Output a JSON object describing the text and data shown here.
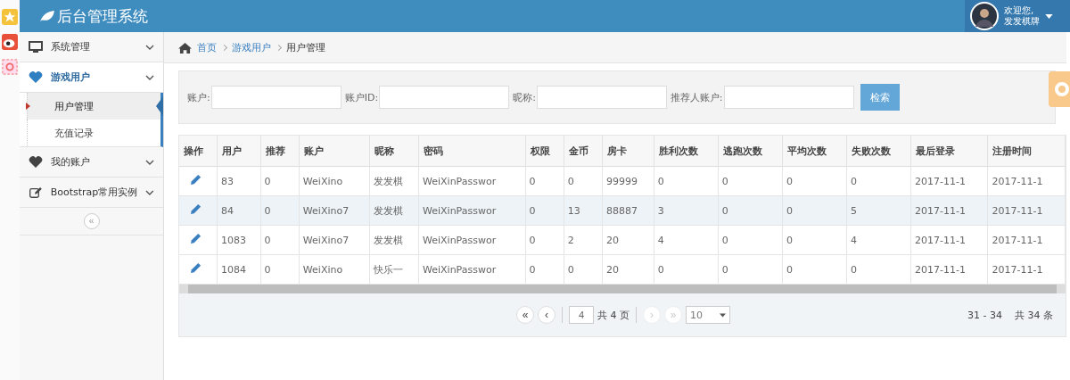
{
  "header": {
    "title": "后台管理系统",
    "user": {
      "greeting": "欢迎您,",
      "name": "发发棋牌"
    }
  },
  "sidebar": {
    "items": [
      {
        "label": "系统管理",
        "selected": false
      },
      {
        "label": "游戏用户",
        "selected": true,
        "children": [
          {
            "label": "用户管理",
            "selected": true
          },
          {
            "label": "充值记录",
            "selected": false
          }
        ]
      },
      {
        "label": "我的账户",
        "selected": false
      },
      {
        "label": "Bootstrap常用实例",
        "selected": false
      }
    ],
    "collapse": "«"
  },
  "breadcrumb": [
    "首页",
    "游戏用户",
    "用户管理"
  ],
  "filters": [
    {
      "label": "账户:"
    },
    {
      "label": "账户ID:"
    },
    {
      "label": "昵称:"
    },
    {
      "label": "推荐人账户:"
    }
  ],
  "search_button": "检索",
  "table": {
    "columns": [
      "操作",
      "用户",
      "推荐",
      "账户",
      "昵称",
      "密码",
      "权限",
      "金币",
      "房卡",
      "胜利次数",
      "逃跑次数",
      "平均次数",
      "失败次数",
      "最后登录",
      "注册时间"
    ],
    "rows": [
      {
        "selected": false,
        "cells": [
          "",
          "83",
          "0",
          "WeiXino",
          "发发棋",
          "WeiXinPasswor",
          "0",
          "0",
          "99999",
          "0",
          "0",
          "0",
          "0",
          "2017-11-1",
          "2017-11-1"
        ]
      },
      {
        "selected": true,
        "cells": [
          "",
          "84",
          "0",
          "WeiXino7",
          "发发棋",
          "WeiXinPasswor",
          "0",
          "13",
          "88887",
          "3",
          "0",
          "0",
          "5",
          "2017-11-1",
          "2017-11-1"
        ]
      },
      {
        "selected": false,
        "cells": [
          "",
          "1083",
          "0",
          "WeiXino7",
          "发发棋",
          "WeiXinPasswor",
          "0",
          "2",
          "20",
          "4",
          "0",
          "0",
          "4",
          "2017-11-1",
          "2017-11-1"
        ]
      },
      {
        "selected": false,
        "cells": [
          "",
          "1084",
          "0",
          "WeiXino",
          "快乐一",
          "WeiXinPasswor",
          "0",
          "0",
          "20",
          "0",
          "0",
          "0",
          "0",
          "2017-11-1",
          "2017-11-1"
        ]
      }
    ]
  },
  "pagination": {
    "buttons": [
      {
        "label": "«",
        "disabled": false
      },
      {
        "label": "‹",
        "disabled": false
      }
    ],
    "page": "4",
    "total_pages": "共 4 页",
    "buttons_after": [
      {
        "label": "›",
        "disabled": true
      },
      {
        "label": "»",
        "disabled": true
      }
    ],
    "page_size": "10",
    "range": "31 - 34",
    "total": "共 34 条"
  }
}
